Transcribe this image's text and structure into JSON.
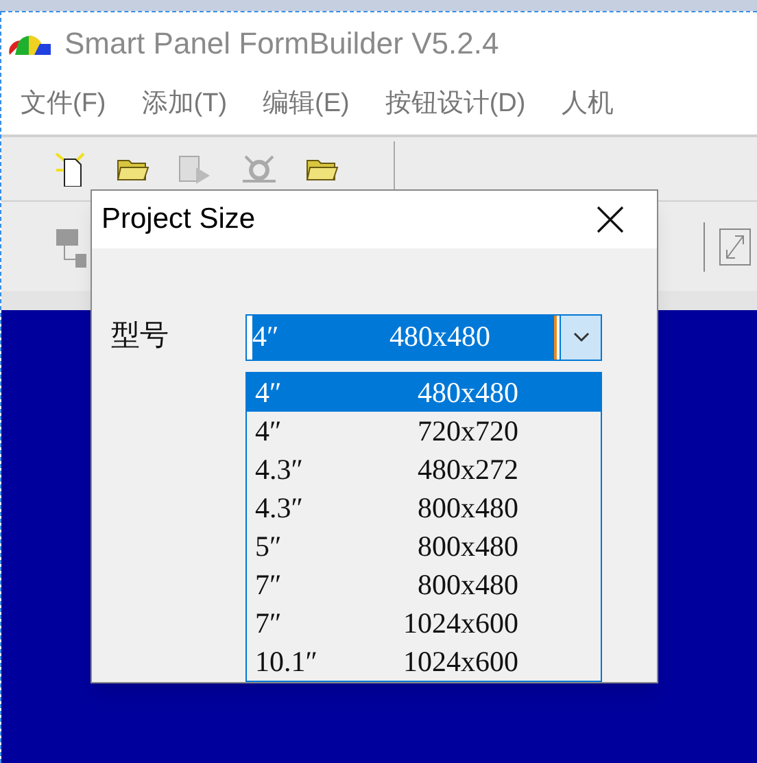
{
  "window": {
    "title": "Smart Panel FormBuilder V5.2.4"
  },
  "menu": [
    "文件(F)",
    "添加(T)",
    "编辑(E)",
    "按钮设计(D)",
    "人机"
  ],
  "dialog": {
    "title": "Project Size",
    "field_label": "型号",
    "combo": {
      "size": "4″",
      "resolution": "480x480"
    },
    "options": [
      {
        "size": "4″",
        "resolution": "480x480",
        "selected": true
      },
      {
        "size": "4″",
        "resolution": "720x720",
        "selected": false
      },
      {
        "size": "4.3″",
        "resolution": "480x272",
        "selected": false
      },
      {
        "size": "4.3″",
        "resolution": "800x480",
        "selected": false
      },
      {
        "size": "5″",
        "resolution": "800x480",
        "selected": false
      },
      {
        "size": "7″",
        "resolution": "800x480",
        "selected": false
      },
      {
        "size": "7″",
        "resolution": "1024x600",
        "selected": false
      },
      {
        "size": "10.1″",
        "resolution": "1024x600",
        "selected": false
      }
    ]
  }
}
